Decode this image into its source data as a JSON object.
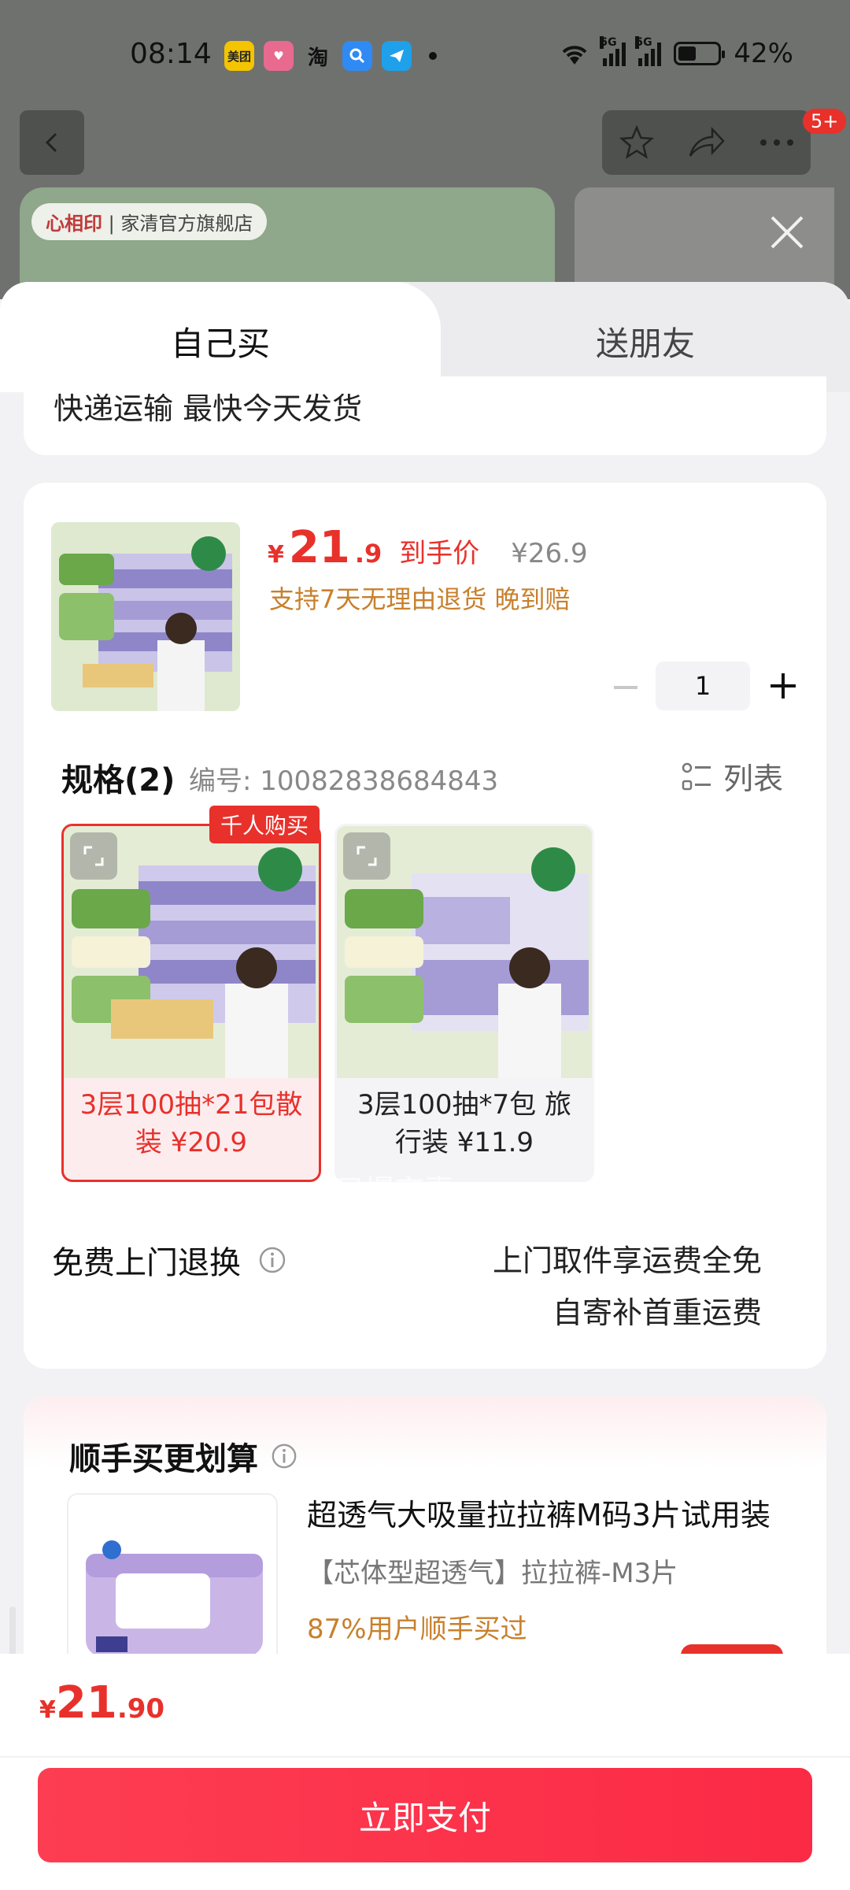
{
  "status_bar": {
    "time": "08:14",
    "apps": [
      "美团",
      "淘"
    ],
    "signal_tag": "5G",
    "battery": "42%"
  },
  "background": {
    "badge": "5+",
    "store_tag_brand": "心相印",
    "store_tag_name": "家清官方旗舰店"
  },
  "tabs": {
    "self_buy": "自己买",
    "send_friend": "送朋友"
  },
  "shipping_note": "快递运输 最快今天发货",
  "product": {
    "currency": "¥",
    "price_int": "21",
    "price_dec": ".9",
    "price_label": "到手价",
    "original_price": "¥26.9",
    "promise": "支持7天无理由退货 晚到赔",
    "quantity": "1"
  },
  "spec": {
    "title": "规格(2)",
    "code": "编号: 10082838684843",
    "list_label": "列表",
    "hot_tag": "千人购买",
    "watermark": "只爆京喜",
    "options": [
      {
        "label": "3层100抽*21包散装 ¥20.9"
      },
      {
        "label": "3层100抽*7包 旅行装 ¥11.9"
      }
    ]
  },
  "returns": {
    "title": "免费上门退换",
    "line1": "上门取件享运费全免",
    "line2": "自寄补首重运费"
  },
  "bundle": {
    "title": "顺手买更划算",
    "name": "超透气大吸量拉拉裤M码3片试用装",
    "spec": "【芯体型超透气】拉拉裤-M3片",
    "stat": "87%用户顺手买过"
  },
  "footer": {
    "currency": "¥",
    "total_int": "21",
    "total_dec": ".90",
    "pay_button": "立即支付"
  },
  "colors": {
    "accent": "#e8312b",
    "promise": "#c8802c"
  }
}
